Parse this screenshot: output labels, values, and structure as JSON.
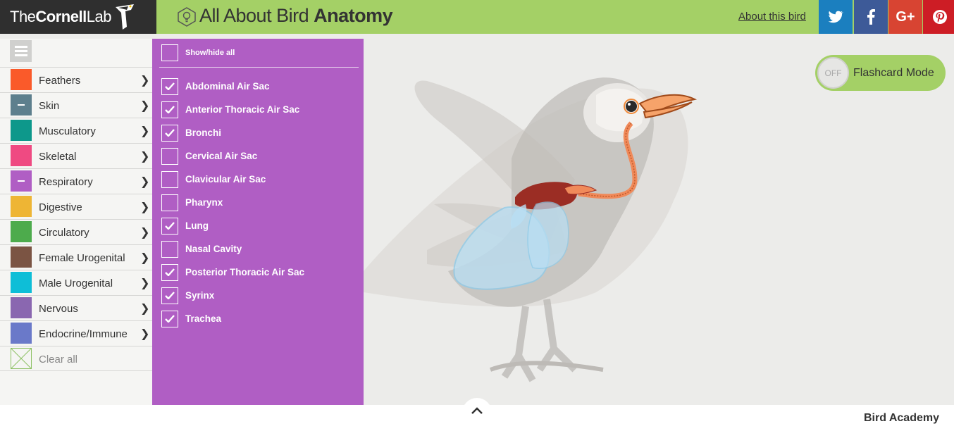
{
  "header": {
    "logo_thin": "The",
    "logo_bold": "Cornell",
    "logo_end": "Lab",
    "title_light": "All About Bird",
    "title_bold": "Anatomy",
    "about_link": "About this bird",
    "social": {
      "twitter": "t",
      "facebook": "f",
      "googleplus": "G+",
      "pinterest": "p"
    },
    "color": "#a4d066"
  },
  "menu": {
    "items": [
      {
        "label": "Feathers",
        "color": "#fa5a2a",
        "expanded": false
      },
      {
        "label": "Skin",
        "color": "#5d7f8d",
        "expanded": true
      },
      {
        "label": "Musculatory",
        "color": "#0d988b",
        "expanded": false
      },
      {
        "label": "Skeletal",
        "color": "#ef4a82",
        "expanded": false
      },
      {
        "label": "Respiratory",
        "color": "#b05ec4",
        "expanded": true
      },
      {
        "label": "Digestive",
        "color": "#eeb534",
        "expanded": false
      },
      {
        "label": "Circulatory",
        "color": "#4dab4c",
        "expanded": false
      },
      {
        "label": "Female Urogenital",
        "color": "#7b5443",
        "expanded": false
      },
      {
        "label": "Male Urogenital",
        "color": "#0ebed7",
        "expanded": false
      },
      {
        "label": "Nervous",
        "color": "#8a67b0",
        "expanded": false
      },
      {
        "label": "Endocrine/Immune",
        "color": "#6a79c9",
        "expanded": false
      }
    ],
    "clear_label": "Clear all"
  },
  "submenu": {
    "show_hide_label": "Show/hide all",
    "color": "#b05ec4",
    "items": [
      {
        "label": "Abdominal Air Sac",
        "checked": true
      },
      {
        "label": "Anterior Thoracic Air Sac",
        "checked": true
      },
      {
        "label": "Bronchi",
        "checked": true
      },
      {
        "label": "Cervical Air Sac",
        "checked": false
      },
      {
        "label": "Clavicular Air Sac",
        "checked": false
      },
      {
        "label": "Pharynx",
        "checked": false
      },
      {
        "label": "Lung",
        "checked": true
      },
      {
        "label": "Nasal Cavity",
        "checked": false
      },
      {
        "label": "Posterior Thoracic Air Sac",
        "checked": true
      },
      {
        "label": "Syrinx",
        "checked": true
      },
      {
        "label": "Trachea",
        "checked": true
      }
    ]
  },
  "flashcard": {
    "state": "OFF",
    "label": "Flashcard Mode"
  },
  "footer": {
    "academy": "Bird Academy"
  }
}
